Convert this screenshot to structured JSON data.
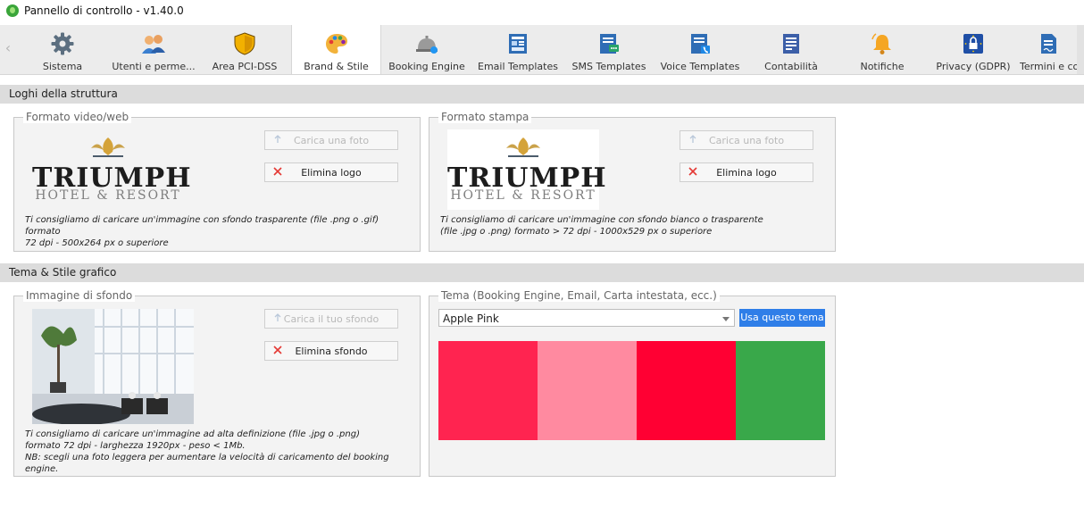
{
  "window": {
    "title": "Pannello di controllo - v1.40.0"
  },
  "toolbar": {
    "scroll_left_glyph": "‹",
    "tabs": [
      {
        "label": "Sistema",
        "icon": "gear-icon"
      },
      {
        "label": "Utenti e perme...",
        "icon": "users-icon"
      },
      {
        "label": "Area PCI-DSS",
        "icon": "shield-icon"
      },
      {
        "label": "Brand & Stile",
        "icon": "palette-icon",
        "active": true
      },
      {
        "label": "Booking Engine",
        "icon": "reception-bell-icon"
      },
      {
        "label": "Email Templates",
        "icon": "email-template-icon"
      },
      {
        "label": "SMS Templates",
        "icon": "sms-template-icon"
      },
      {
        "label": "Voice Templates",
        "icon": "voice-template-icon"
      },
      {
        "label": "Contabilità",
        "icon": "accounting-icon"
      },
      {
        "label": "Notifiche",
        "icon": "bell-icon"
      },
      {
        "label": "Privacy (GDPR)",
        "icon": "gdpr-lock-icon"
      },
      {
        "label": "Termini e co",
        "icon": "terms-document-icon"
      }
    ]
  },
  "sections": {
    "logos": {
      "header": "Loghi della struttura",
      "web": {
        "legend": "Formato video/web",
        "logo_text": "TRIUMPH",
        "logo_sub": "HOTEL & RESORT",
        "upload_label": "Carica una foto",
        "delete_label": "Elimina logo",
        "hint_line1": "Ti consigliamo di caricare un'immagine con sfondo trasparente (file .png o .gif) formato",
        "hint_line2": "72 dpi - 500x264 px o superiore"
      },
      "print": {
        "legend": "Formato stampa",
        "logo_text": "TRIUMPH",
        "logo_sub": "HOTEL & RESORT",
        "upload_label": "Carica una foto",
        "delete_label": "Elimina logo",
        "hint_line1": "Ti consigliamo di caricare un'immagine con sfondo bianco o trasparente",
        "hint_line2": "(file .jpg o .png) formato > 72 dpi - 1000x529 px o superiore"
      }
    },
    "theme": {
      "header": "Tema & Stile grafico",
      "background": {
        "legend": "Immagine di sfondo",
        "upload_label": "Carica il tuo sfondo",
        "delete_label": "Elimina sfondo",
        "hint_line1": "Ti consigliamo di caricare un'immagine ad alta definizione (file .jpg o .png)",
        "hint_line2": "formato 72 dpi - larghezza 1920px - peso < 1Mb.",
        "hint_line3": "NB: scegli una foto leggera per aumentare la velocità di caricamento del booking engine."
      },
      "palette": {
        "legend": "Tema (Booking Engine, Email, Carta intestata, ecc.)",
        "selected": "Apple Pink",
        "apply_label": "Usa questo tema",
        "colors": [
          "#ff2450",
          "#ff8aa0",
          "#ff0033",
          "#39a84a"
        ]
      }
    }
  },
  "colors": {
    "primary_button": "#2f7ee8",
    "delete_icon": "#e53935",
    "section_header_bg": "#dcdcdc"
  }
}
